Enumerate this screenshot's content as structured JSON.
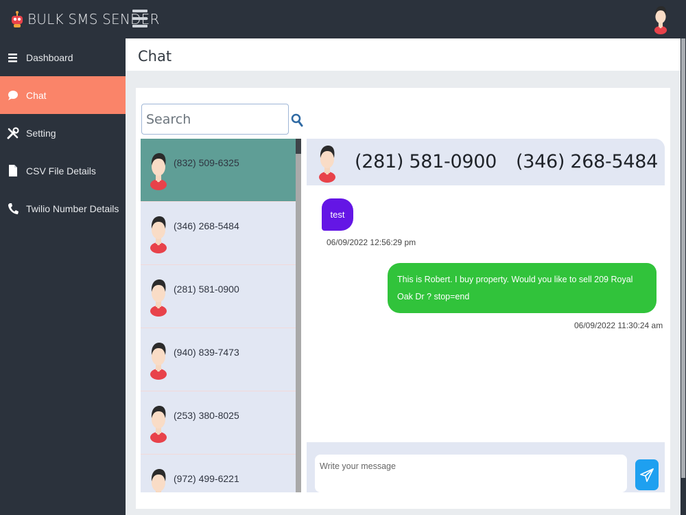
{
  "app": {
    "title": "BULK SMS SENDER"
  },
  "icons": {
    "logo": "robot-logo-icon",
    "menu": "hamburger-menu-icon",
    "profile": "user-avatar-icon",
    "search": "search-icon",
    "send": "paper-plane-icon"
  },
  "sidebar": {
    "items": [
      {
        "label": "Dashboard",
        "icon": "menu-lines-icon",
        "active": false
      },
      {
        "label": "Chat",
        "icon": "chat-bubble-icon",
        "active": true
      },
      {
        "label": "Setting",
        "icon": "tools-icon",
        "active": false
      },
      {
        "label": "CSV File Details",
        "icon": "file-icon",
        "active": false
      },
      {
        "label": "Twilio Number Details",
        "icon": "phone-icon",
        "active": false
      }
    ]
  },
  "page": {
    "title": "Chat"
  },
  "search": {
    "placeholder": "Search"
  },
  "contacts": [
    {
      "number": "(832) 509-6325",
      "active": true
    },
    {
      "number": "(346) 268-5484",
      "active": false
    },
    {
      "number": "(281) 581-0900",
      "active": false
    },
    {
      "number": "(940) 839-7473",
      "active": false
    },
    {
      "number": "(253) 380-8025",
      "active": false
    },
    {
      "number": "(972) 499-6221",
      "active": false
    }
  ],
  "conversation": {
    "contact_number": "(281) 581-0900",
    "my_number": "(346) 268-5484",
    "messages": [
      {
        "direction": "in",
        "text": "test",
        "time": "06/09/2022 12:56:29 pm"
      },
      {
        "direction": "out",
        "text": "This is Robert. I buy property. Would you like to sell 209 Royal Oak Dr ? stop=end",
        "time": "06/09/2022 11:30:24 am"
      }
    ]
  },
  "composer": {
    "placeholder": "Write your message"
  },
  "colors": {
    "sidebar_bg": "#2b323c",
    "active_nav": "#fa8469",
    "active_contact": "#5f9e96",
    "incoming_bubble": "#6416e5",
    "outgoing_bubble": "#31c33b",
    "send_button": "#1ea0f0"
  }
}
